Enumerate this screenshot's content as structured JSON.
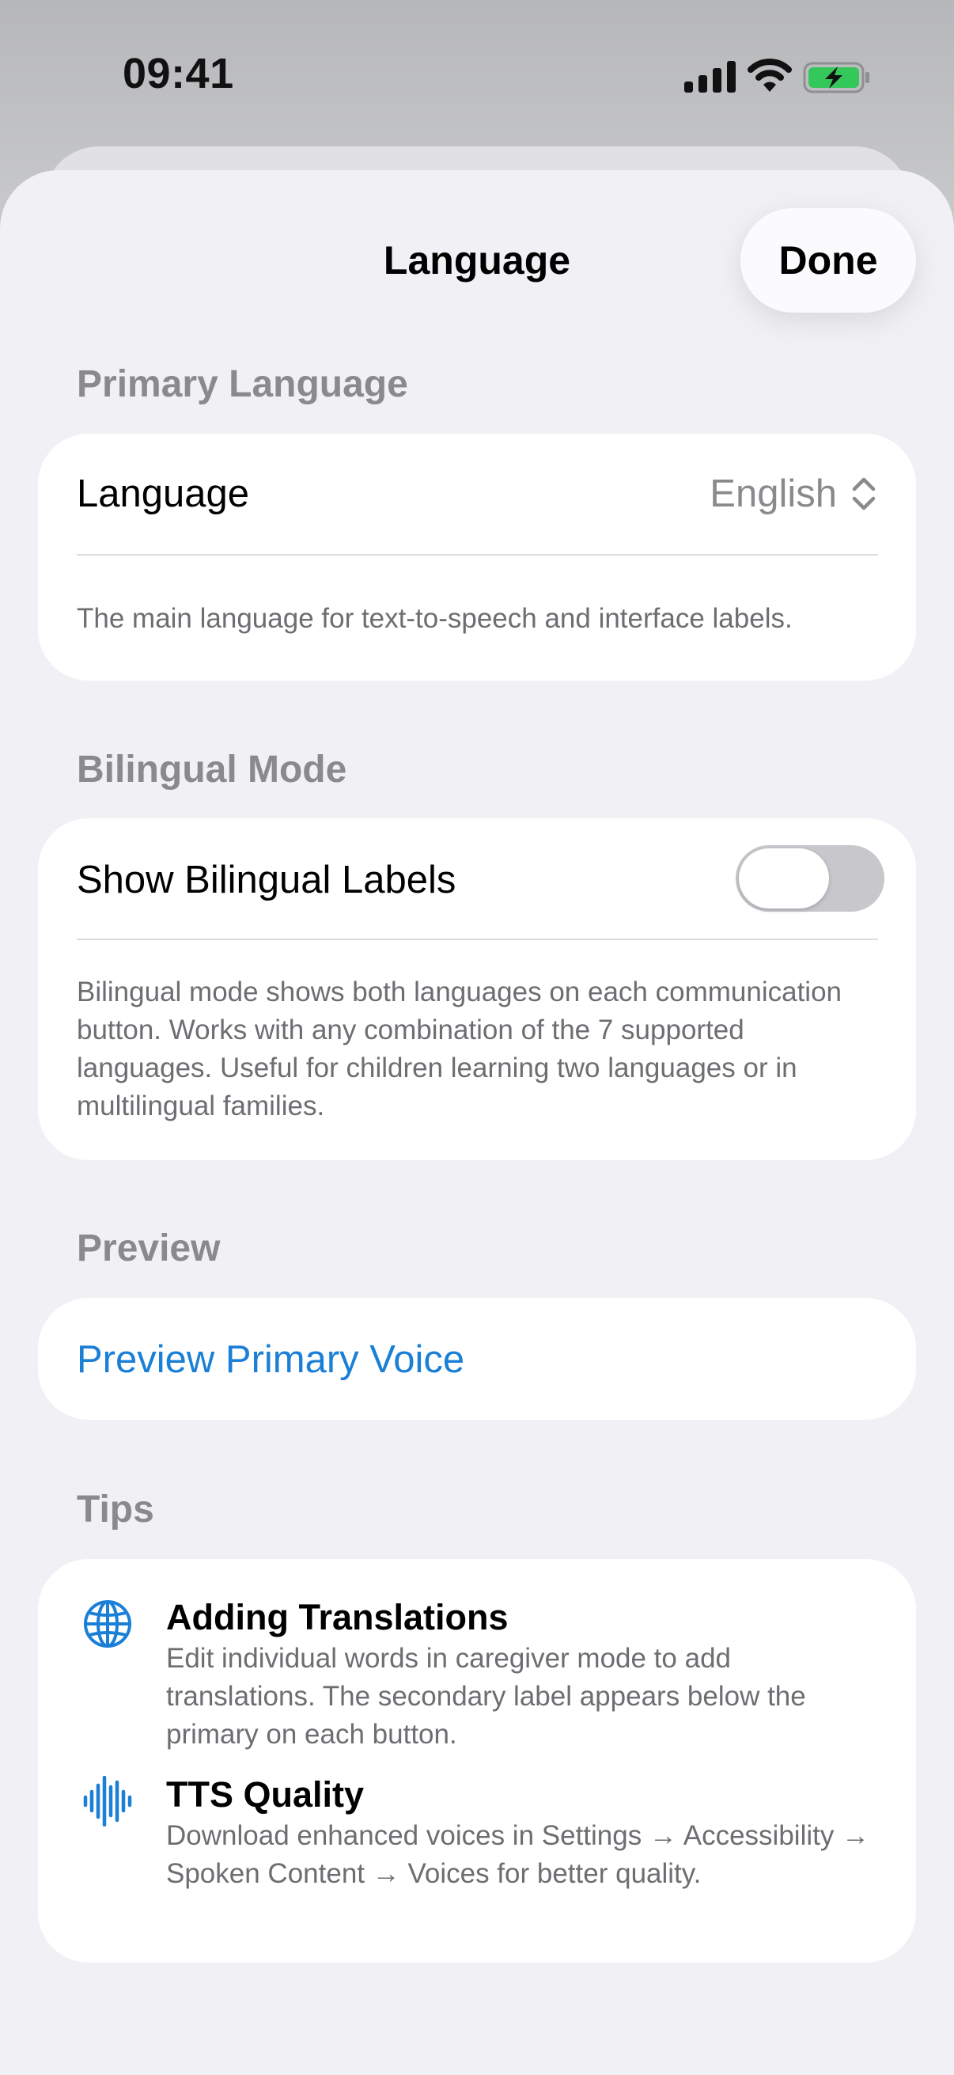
{
  "status_bar": {
    "time": "09:41",
    "icons": [
      "cellular-signal-icon",
      "wifi-icon",
      "battery-charging-icon"
    ],
    "battery_color": "#34c759"
  },
  "sheet": {
    "title": "Language",
    "done_label": "Done"
  },
  "sections": {
    "primary": {
      "header": "Primary Language",
      "row_label": "Language",
      "row_value": "English",
      "footnote": "The main language for text-to-speech and interface labels."
    },
    "bilingual": {
      "header": "Bilingual Mode",
      "row_label": "Show Bilingual Labels",
      "toggle_on": false,
      "footnote": "Bilingual mode shows both languages on each communication button. Works with any combination of the 7 supported languages. Useful for children learning two languages or in multilingual families."
    },
    "preview": {
      "header": "Preview",
      "button_label": "Preview Primary Voice"
    },
    "tips": {
      "header": "Tips",
      "items": [
        {
          "icon": "globe-icon",
          "title": "Adding Translations",
          "text": "Edit individual words in caregiver mode to add translations. The secondary label appears below the primary on each button."
        },
        {
          "icon": "waveform-icon",
          "title": "TTS Quality",
          "text": "Download enhanced voices in Settings → Accessibility → Spoken Content → Voices for better quality."
        }
      ]
    }
  },
  "colors": {
    "accent": "#1a7fd6",
    "background": "#f1f1f5",
    "secondary_text": "#8a8a8e"
  }
}
